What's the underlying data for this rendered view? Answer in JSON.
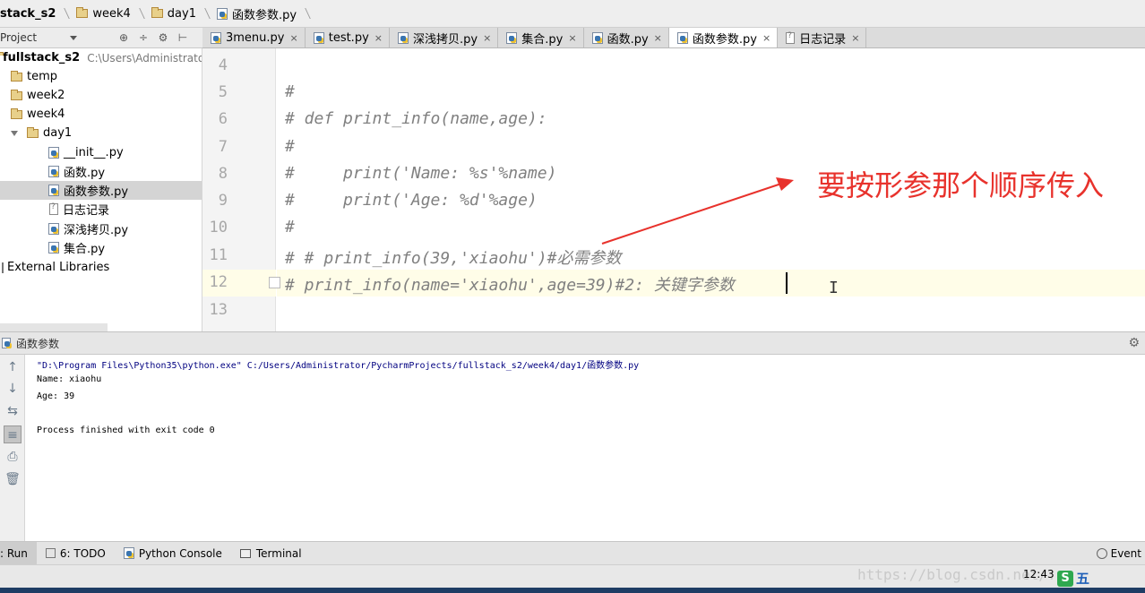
{
  "breadcrumb": [
    {
      "label": "stack_s2",
      "icon": "none"
    },
    {
      "label": "week4",
      "icon": "folder-icon"
    },
    {
      "label": "day1",
      "icon": "folder-icon"
    },
    {
      "label": "函数参数.py",
      "icon": "python-file-icon"
    }
  ],
  "project_toolbar": {
    "label": "Project"
  },
  "tabs": [
    {
      "label": "3menu.py",
      "icon": "python-file-icon",
      "close": "×"
    },
    {
      "label": "test.py",
      "icon": "python-file-icon",
      "close": "×"
    },
    {
      "label": "深浅拷贝.py",
      "icon": "python-file-icon",
      "close": "×"
    },
    {
      "label": "集合.py",
      "icon": "python-file-icon",
      "close": "×"
    },
    {
      "label": "函数.py",
      "icon": "python-file-icon",
      "close": "×"
    },
    {
      "label": "函数参数.py",
      "icon": "python-file-icon",
      "close": "×",
      "active": true
    },
    {
      "label": "日志记录",
      "icon": "text-file-icon",
      "close": "×"
    }
  ],
  "tree": {
    "root_label": "fullstack_s2",
    "root_path": "C:\\Users\\Administrator",
    "items": [
      {
        "label": "temp",
        "icon": "folder-icon"
      },
      {
        "label": "week2",
        "icon": "folder-icon"
      },
      {
        "label": "week4",
        "icon": "folder-icon"
      },
      {
        "label": "day1",
        "icon": "folder-icon",
        "expanded": true
      },
      {
        "label": "__init__.py",
        "icon": "python-file-icon"
      },
      {
        "label": "函数.py",
        "icon": "python-file-icon"
      },
      {
        "label": "函数参数.py",
        "icon": "python-file-icon",
        "selected": true
      },
      {
        "label": "日志记录",
        "icon": "text-file-icon"
      },
      {
        "label": "深浅拷贝.py",
        "icon": "python-file-icon"
      },
      {
        "label": "集合.py",
        "icon": "python-file-icon"
      },
      {
        "label": "External Libraries",
        "icon": "library-icon"
      }
    ]
  },
  "editor": {
    "lines": [
      {
        "no": "4",
        "code": ""
      },
      {
        "no": "5",
        "code": "#"
      },
      {
        "no": "6",
        "code": "# def print_info(name,age):"
      },
      {
        "no": "7",
        "code": "#"
      },
      {
        "no": "8",
        "code": "#     print('Name: %s'%name)"
      },
      {
        "no": "9",
        "code": "#     print('Age: %d'%age)"
      },
      {
        "no": "10",
        "code": "#"
      },
      {
        "no": "11",
        "code": "# # print_info(39,'xiaohu')#必需参数"
      },
      {
        "no": "12",
        "code": "# print_info(name='xiaohu',age=39)#2: 关键字参数"
      },
      {
        "no": "13",
        "code": ""
      }
    ],
    "annotation": "要按形参那个顺序传入",
    "annotation_color": "#e8322c"
  },
  "run_panel": {
    "title": "函数参数",
    "output": [
      "\"D:\\Program Files\\Python35\\python.exe\" C:/Users/Administrator/PycharmProjects/fullstack_s2/week4/day1/函数参数.py",
      "Name: xiaohu",
      "Age: 39",
      "",
      "Process finished with exit code 0"
    ]
  },
  "bottom_tabs": [
    {
      "label": ": Run",
      "icon": "none"
    },
    {
      "label": "6: TODO",
      "icon": "todo-icon"
    },
    {
      "label": "Python Console",
      "icon": "python-console-icon"
    },
    {
      "label": "Terminal",
      "icon": "terminal-icon"
    }
  ],
  "event_log": "Event",
  "status": {
    "time": "12:43",
    "watermark": "https://blog.csdn.net/..."
  },
  "ime": {
    "s": "S",
    "w": "五"
  }
}
